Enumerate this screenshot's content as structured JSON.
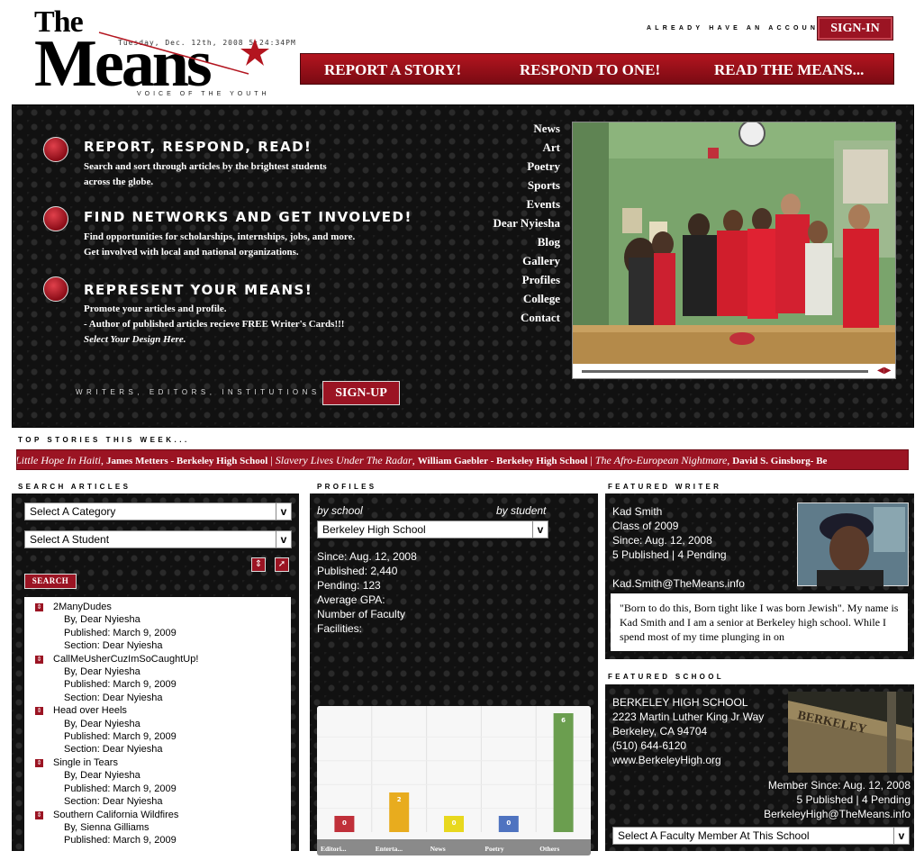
{
  "header": {
    "logo_the": "The",
    "logo_means": "Means",
    "logo_date": "Tuesday, Dec. 12th, 2008  5:24:34PM",
    "logo_tagline": "VOICE OF THE YOUTH",
    "account_prompt": "ALREADY HAVE AN ACCOUNT?",
    "signin_label": "SIGN-IN",
    "nav": [
      "REPORT A STORY!",
      "RESPOND TO ONE!",
      "READ THE MEANS..."
    ]
  },
  "hero": {
    "features": [
      {
        "title": "REPORT, RESPOND, READ!",
        "lines": [
          "Search and sort through articles by the brightest students",
          "across the globe."
        ]
      },
      {
        "title": "FIND NETWORKS AND GET INVOLVED!",
        "lines": [
          "Find opportunities for scholarships, internships, jobs, and more.",
          "Get involved with local and national organizations."
        ]
      },
      {
        "title": "REPRESENT YOUR MEANS!",
        "lines": [
          "Promote your articles and profile.",
          "- Author of published articles recieve FREE Writer's Cards!!!",
          "Select Your Design Here."
        ]
      }
    ],
    "writers_label": "WRITERS, EDITORS, INSTITUTIONS >>",
    "signup_label": "SIGN-UP",
    "side_nav": [
      "News",
      "Art",
      "Poetry",
      "Sports",
      "Events",
      "Dear Nyiesha",
      "Blog",
      "Gallery",
      "Profiles",
      "College",
      "Contact"
    ]
  },
  "ticker": {
    "label": "TOP STORIES THIS WEEK...",
    "items": [
      {
        "title": "Little Hope In Haiti",
        "byline": "James Metters - Berkeley High School"
      },
      {
        "title": "Slavery Lives Under The Radar",
        "byline": "William Gaebler - Berkeley High School"
      },
      {
        "title": "The Afro-European Nightmare",
        "byline": "David S. Ginsborg- Be"
      }
    ]
  },
  "search": {
    "label": "SEARCH ARTICLES",
    "category_select": "Select A Category",
    "student_select": "Select A Student",
    "search_button": "SEARCH",
    "articles": [
      {
        "title": "2ManyDudes",
        "by": "By, Dear Nyiesha",
        "published": "Published: March 9, 2009",
        "section": "Section: Dear Nyiesha"
      },
      {
        "title": "CallMeUsherCuzImSoCaughtUp!",
        "by": "By, Dear Nyiesha",
        "published": "Published: March 9, 2009",
        "section": "Section: Dear Nyiesha"
      },
      {
        "title": "Head over Heels",
        "by": "By, Dear Nyiesha",
        "published": "Published: March 9, 2009",
        "section": "Section: Dear Nyiesha"
      },
      {
        "title": "Single in Tears",
        "by": "By, Dear Nyiesha",
        "published": "Published: March 9, 2009",
        "section": "Section: Dear Nyiesha"
      },
      {
        "title": "Southern California Wildfires",
        "by": "By, Sienna Gilliams",
        "published": "Published: March 9, 2009",
        "section": ""
      }
    ]
  },
  "profiles": {
    "label": "PROFILES",
    "by_school": "by school",
    "by_student": "by student",
    "school_select": "Berkeley High School",
    "since": "Since: Aug. 12, 2008",
    "published": "Published: 2,440",
    "pending": "Pending: 123",
    "gpa": "Average GPA:",
    "faculty": "Number of Faculty",
    "facilities": "Facilities:"
  },
  "chart_data": {
    "type": "bar",
    "categories": [
      "Editori...",
      "Enterta...",
      "News",
      "Poetry",
      "Others"
    ],
    "values": [
      0,
      2,
      0,
      0,
      6
    ],
    "ylim": [
      0,
      6
    ],
    "colors": [
      "#c0303a",
      "#e8ac1e",
      "#e8d81e",
      "#4f73c0",
      "#6b9e4f"
    ]
  },
  "featured_writer": {
    "label": "FEATURED WRITER",
    "name": "Kad Smith",
    "class": "Class of 2009",
    "since": "Since: Aug. 12, 2008",
    "stats": "5 Published | 4 Pending",
    "email": "Kad.Smith@TheMeans.info",
    "quote": "\"Born to do this, Born tight like I was born Jewish\". My name is Kad Smith and I am a senior at Berkeley high school. While I spend most of my time plunging in on"
  },
  "featured_school": {
    "label": "FEATURED SCHOOL",
    "name": "BERKELEY HIGH SCHOOL",
    "address1": "2223 Martin Luther King Jr Way",
    "address2": "Berkeley, CA 94704",
    "phone": "(510) 644-6120",
    "website": "www.BerkeleyHigh.org",
    "member_since": "Member Since: Aug. 12, 2008",
    "stats": "5 Published | 4 Pending",
    "email": "BerkeleyHigh@TheMeans.info",
    "faculty_select": "Select A Faculty Member At This School"
  }
}
